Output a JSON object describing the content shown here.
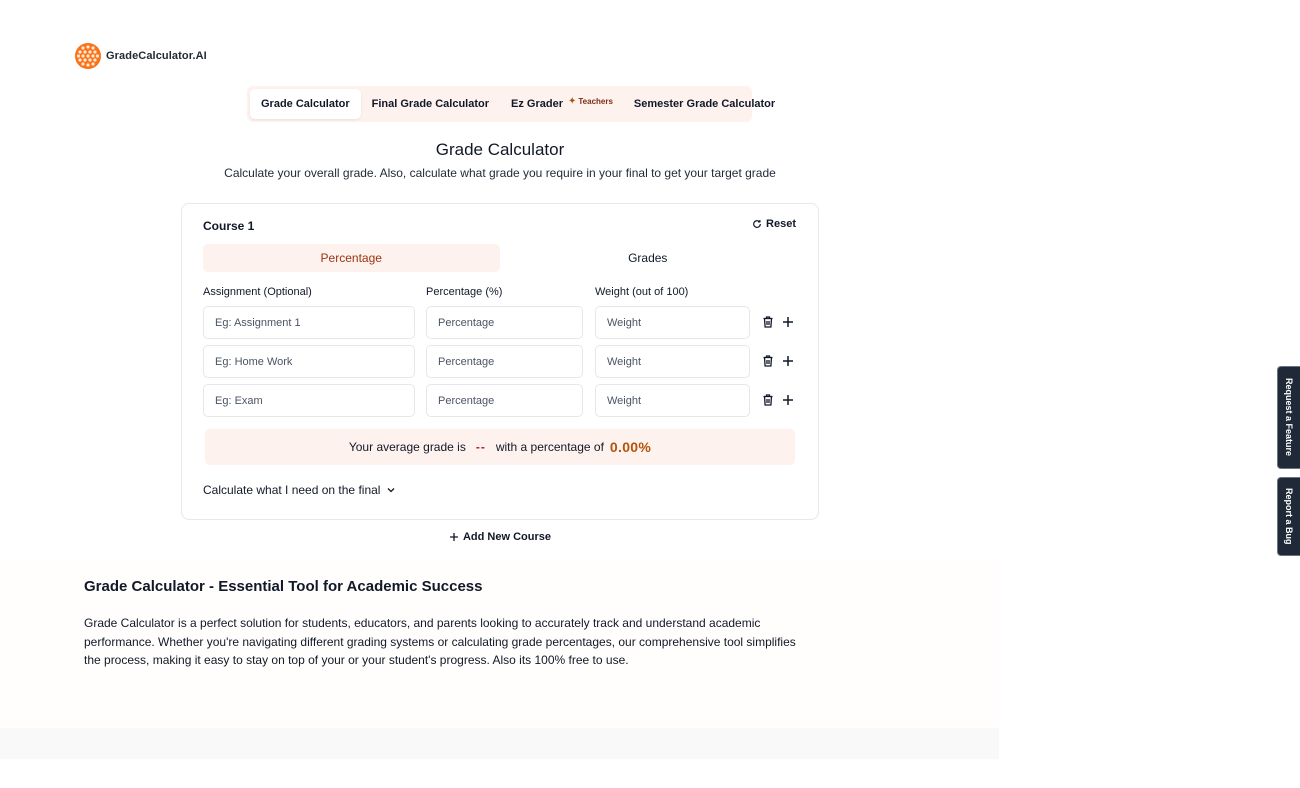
{
  "brand": {
    "name": "GradeCalculator.AI",
    "accent": "#ea580c"
  },
  "tabs": [
    {
      "label": "Grade Calculator",
      "active": true
    },
    {
      "label": "Final Grade Calculator",
      "active": false
    },
    {
      "label": "Ez Grader",
      "active": false,
      "badge": "Teachers"
    },
    {
      "label": "Semester Grade Calculator",
      "active": false
    }
  ],
  "header": {
    "title": "Grade Calculator",
    "subtitle": "Calculate your overall grade. Also, calculate what grade you require in your final to get your target grade"
  },
  "course": {
    "title": "Course 1",
    "reset_label": "Reset",
    "modes": [
      "Percentage",
      "Grades"
    ],
    "active_mode": "Percentage",
    "columns": {
      "assignment": "Assignment (Optional)",
      "percentage": "Percentage (%)",
      "weight": "Weight (out of 100)"
    },
    "rows": [
      {
        "assignment_placeholder": "Eg: Assignment 1",
        "percentage_placeholder": "Percentage",
        "weight_placeholder": "Weight"
      },
      {
        "assignment_placeholder": "Eg: Home Work",
        "percentage_placeholder": "Percentage",
        "weight_placeholder": "Weight"
      },
      {
        "assignment_placeholder": "Eg: Exam",
        "percentage_placeholder": "Percentage",
        "weight_placeholder": "Weight"
      }
    ],
    "summary": {
      "prefix": "Your average grade is",
      "grade": "--",
      "middle": "with a percentage of",
      "percentage": "0.00%"
    },
    "final_toggle": "Calculate what I need on the final"
  },
  "add_course_label": "Add New Course",
  "article": {
    "title": "Grade Calculator - Essential Tool for Academic Success",
    "body": "Grade Calculator is a perfect solution for students, educators, and parents looking to accurately track and understand academic performance. Whether you're navigating different grading systems or calculating grade percentages, our comprehensive tool simplifies the process, making it easy to stay on top of your or your student's progress. Also its 100% free to use."
  },
  "side_tabs": {
    "feature": "Request a Feature",
    "bug": "Report a Bug"
  }
}
